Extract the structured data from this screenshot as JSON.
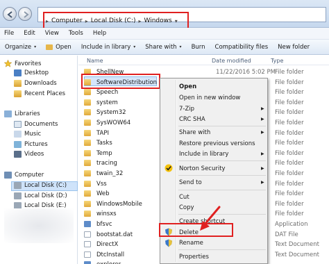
{
  "address": {
    "crumbs": [
      "Computer",
      "Local Disk (C:)",
      "Windows"
    ],
    "separator": "▸",
    "dropdown": "▾"
  },
  "menu": [
    "File",
    "Edit",
    "View",
    "Tools",
    "Help"
  ],
  "toolbar": {
    "organize": "Organize",
    "open": "Open",
    "include": "Include in library",
    "share": "Share with",
    "burn": "Burn",
    "compat": "Compatibility files",
    "new_folder": "New folder",
    "arrow": "▾"
  },
  "nav": {
    "favorites": "Favorites",
    "desktop": "Desktop",
    "downloads": "Downloads",
    "recent": "Recent Places",
    "libraries": "Libraries",
    "documents": "Documents",
    "music": "Music",
    "pictures": "Pictures",
    "videos": "Videos",
    "computer": "Computer",
    "disk_c": "Local Disk (C:)",
    "disk_d": "Local Disk (D:)",
    "disk_e": "Local Disk (E:)"
  },
  "columns": {
    "name": "Name",
    "date": "Date modified",
    "type": "Type"
  },
  "files": [
    {
      "name": "ShellNew",
      "date": "11/22/2016 5:02 PM",
      "type": "File folder",
      "kind": "folder"
    },
    {
      "name": "SoftwareDistribution",
      "date": "",
      "type": "File folder",
      "kind": "folder"
    },
    {
      "name": "Speech",
      "date": "",
      "type": "File folder",
      "kind": "folder"
    },
    {
      "name": "system",
      "date": "",
      "type": "File folder",
      "kind": "folder"
    },
    {
      "name": "System32",
      "date": "",
      "type": "File folder",
      "kind": "folder"
    },
    {
      "name": "SysWOW64",
      "date": "",
      "type": "File folder",
      "kind": "folder"
    },
    {
      "name": "TAPI",
      "date": "",
      "type": "File folder",
      "kind": "folder"
    },
    {
      "name": "Tasks",
      "date": "",
      "type": "File folder",
      "kind": "folder"
    },
    {
      "name": "Temp",
      "date": "",
      "type": "File folder",
      "kind": "folder"
    },
    {
      "name": "tracing",
      "date": "",
      "type": "File folder",
      "kind": "folder"
    },
    {
      "name": "twain_32",
      "date": "",
      "type": "File folder",
      "kind": "folder"
    },
    {
      "name": "Vss",
      "date": "",
      "type": "File folder",
      "kind": "folder"
    },
    {
      "name": "Web",
      "date": "",
      "type": "File folder",
      "kind": "folder"
    },
    {
      "name": "WindowsMobile",
      "date": "",
      "type": "File folder",
      "kind": "folder"
    },
    {
      "name": "winsxs",
      "date": "",
      "type": "File folder",
      "kind": "folder"
    },
    {
      "name": "bfsvc",
      "date": "",
      "type": "Application",
      "kind": "exe"
    },
    {
      "name": "bootstat.dat",
      "date": "",
      "type": "DAT File",
      "kind": "file"
    },
    {
      "name": "DirectX",
      "date": "",
      "type": "Text Document",
      "kind": "file"
    },
    {
      "name": "DtcInstall",
      "date": "",
      "type": "Text Document",
      "kind": "file"
    },
    {
      "name": "explorer",
      "date": "",
      "type": "",
      "kind": "exe"
    }
  ],
  "context_menu": {
    "open": "Open",
    "open_new": "Open in new window",
    "zip": "7-Zip",
    "crc": "CRC SHA",
    "share": "Share with",
    "restore": "Restore previous versions",
    "include": "Include in library",
    "norton": "Norton Security",
    "send_to": "Send to",
    "cut": "Cut",
    "copy": "Copy",
    "shortcut": "Create shortcut",
    "delete": "Delete",
    "rename": "Rename",
    "properties": "Properties",
    "submenu_arrow": "▶"
  },
  "colors": {
    "highlight_box": "#e02020",
    "selection": "#d5e6fb",
    "folder": "#e6b64a"
  }
}
